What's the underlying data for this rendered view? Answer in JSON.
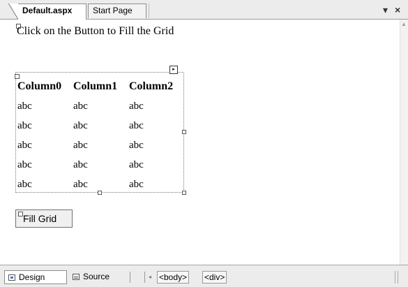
{
  "tabs": [
    {
      "label": "Default.aspx",
      "active": true
    },
    {
      "label": "Start Page",
      "active": false
    }
  ],
  "title_controls": {
    "pin": "▾",
    "close": "×"
  },
  "design": {
    "intro_label": "Click on the Button to Fill the Grid",
    "grid": {
      "columns": [
        "Column0",
        "Column1",
        "Column2"
      ],
      "rows": [
        [
          "abc",
          "abc",
          "abc"
        ],
        [
          "abc",
          "abc",
          "abc"
        ],
        [
          "abc",
          "abc",
          "abc"
        ],
        [
          "abc",
          "abc",
          "abc"
        ],
        [
          "abc",
          "abc",
          "abc"
        ]
      ]
    },
    "smart_tag": "▸",
    "button_label": "Fill Grid"
  },
  "bottom": {
    "design_tab": "Design",
    "source_tab": "Source",
    "crumbs": [
      "<body>",
      "<div>"
    ]
  },
  "icons": [
    "pin-icon",
    "close-icon",
    "smart-tag-icon",
    "design-view-icon",
    "source-view-icon"
  ],
  "colors": {
    "chrome": "#ececec",
    "surface": "#ffffff",
    "border": "#8d8d8d"
  }
}
